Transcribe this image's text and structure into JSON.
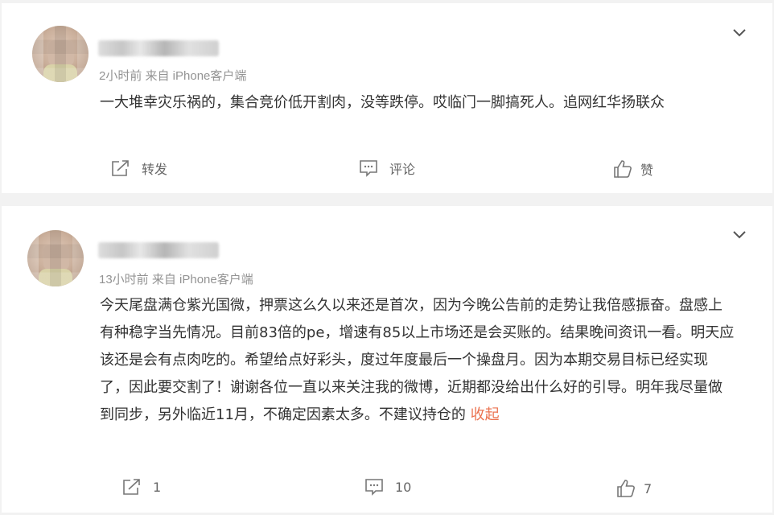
{
  "posts": [
    {
      "time_source": "2小时前 来自 iPhone客户端",
      "text": "一大堆幸灾乐祸的，集合竞价低开割肉，没等跌停。哎临门一脚搞死人。追网红华扬联众",
      "collapse_label": "",
      "actions": {
        "repost": "转发",
        "comment": "评论",
        "like": "赞"
      }
    },
    {
      "time_source": "13小时前 来自 iPhone客户端",
      "text": "今天尾盘满仓紫光国微，押票这么久以来还是首次，因为今晚公告前的走势让我倍感振奋。盘感上有种稳字当先情况。目前83倍的pe，增速有85以上市场还是会买账的。结果晚间资讯一看。明天应该还是会有点肉吃的。希望给点好彩头，度过年度最后一个操盘月。因为本期交易目标已经实现了，因此要交割了！谢谢各位一直以来关注我的微博，近期都没给出什么好的引导。明年我尽量做到同步，另外临近11月，不确定因素太多。不建议持仓的",
      "collapse_label": "收起",
      "actions": {
        "repost": "1",
        "comment": "10",
        "like": "7"
      }
    }
  ],
  "icons": {
    "menu": "chevron-down-icon",
    "repost": "share-icon",
    "comment": "comment-icon",
    "like": "thumbs-up-icon"
  },
  "colors": {
    "link": "#eb7350",
    "meta": "#939393",
    "text": "#333333",
    "background": "#f2f2f2"
  }
}
